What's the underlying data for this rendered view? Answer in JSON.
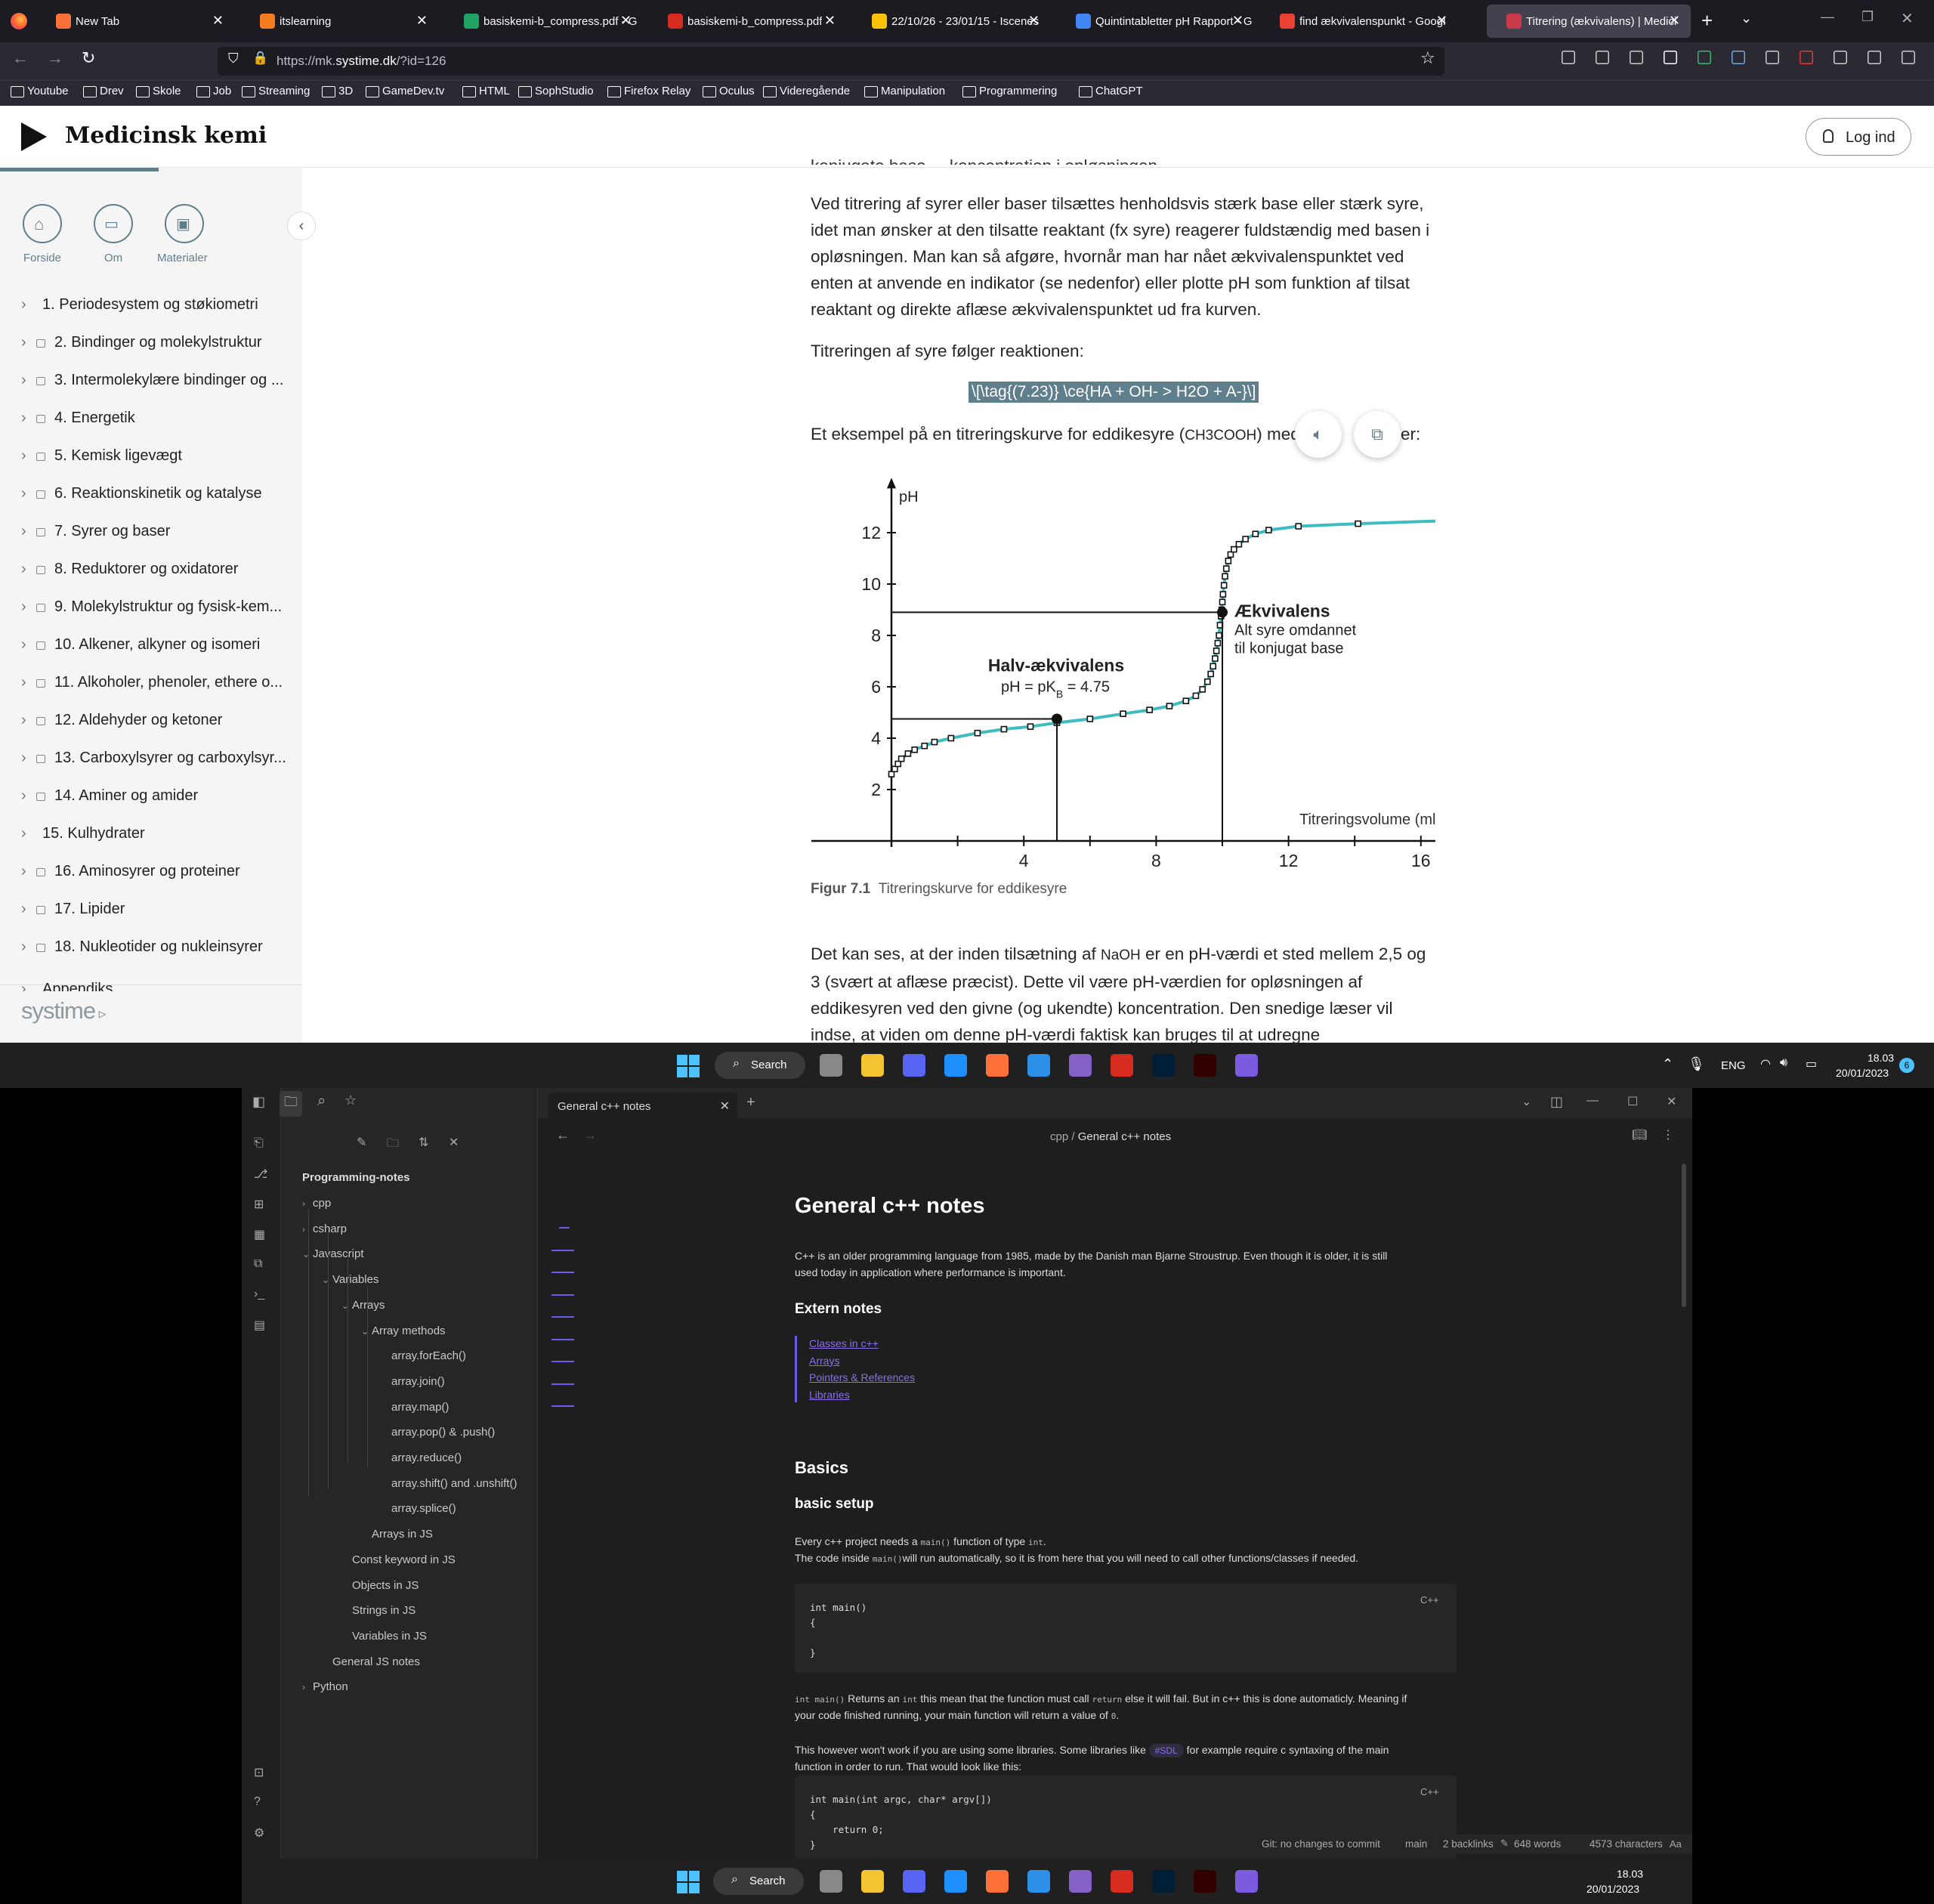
{
  "browser": {
    "tabs": [
      {
        "label": "New Tab",
        "color": "#ff7139"
      },
      {
        "label": "itslearning",
        "color": "#f47c20"
      },
      {
        "label": "basiskemi-b_compress.pdf - G",
        "color": "#1fa463"
      },
      {
        "label": "basiskemi-b_compress.pdf",
        "color": "#d62c1f"
      },
      {
        "label": "22/10/26 - 23/01/15 - Iscenes",
        "color": "#ffc107"
      },
      {
        "label": "Quintintabletter pH Rapport - G",
        "color": "#4285f4"
      },
      {
        "label": "find ækvivalenspunkt - Googl",
        "color": "#ea4335"
      },
      {
        "label": "Titrering (ækvivalens) | Medici",
        "color": "#c93a4a"
      }
    ],
    "url_prefix": "https://mk.",
    "url_domain": "systime.dk",
    "url_path": "/?id=126",
    "bookmarks": [
      "Youtube",
      "Drev",
      "Skole",
      "Job",
      "Streaming",
      "3D",
      "GameDev.tv",
      "HTML",
      "SophStudio",
      "Firefox Relay",
      "Oculus",
      "Videregående",
      "Manipulation",
      "Programmering",
      "ChatGPT"
    ]
  },
  "site": {
    "title": "Medicinsk kemi",
    "login": "Log ind",
    "nav": [
      "Forside",
      "Om",
      "Materialer"
    ],
    "chapters": [
      {
        "label": "1. Periodesystem og støkiometri",
        "locked": false
      },
      {
        "label": "2. Bindinger og molekylstruktur",
        "locked": true
      },
      {
        "label": "3. Intermolekylære bindinger og ...",
        "locked": true
      },
      {
        "label": "4. Energetik",
        "locked": true
      },
      {
        "label": "5. Kemisk ligevægt",
        "locked": true
      },
      {
        "label": "6. Reaktionskinetik og katalyse",
        "locked": true
      },
      {
        "label": "7. Syrer og baser",
        "locked": true
      },
      {
        "label": "8. Reduktorer og oxidatorer",
        "locked": true
      },
      {
        "label": "9. Molekylstruktur og fysisk-kem...",
        "locked": true
      },
      {
        "label": "10. Alkener, alkyner og isomeri",
        "locked": true
      },
      {
        "label": "11. Alkoholer, phenoler, ethere o...",
        "locked": true
      },
      {
        "label": "12. Aldehyder og ketoner",
        "locked": true
      },
      {
        "label": "13. Carboxylsyrer og carboxylsyr...",
        "locked": true
      },
      {
        "label": "14. Aminer og amider",
        "locked": true
      },
      {
        "label": "15. Kulhydrater",
        "locked": false
      },
      {
        "label": "16. Aminosyrer og proteiner",
        "locked": true
      },
      {
        "label": "17. Lipider",
        "locked": true
      },
      {
        "label": "18. Nukleotider og nukleinsyrer",
        "locked": true
      },
      {
        "label": "Appendiks",
        "locked": false
      }
    ],
    "brand": "systime",
    "top_cut": "konjugate base ... koncentration i opløsningen.",
    "para1": "Ved titrering af syrer eller baser tilsættes henholdsvis stærk base eller stærk syre, idet man ønsker at den tilsatte reaktant (fx syre) reagerer fuldstændig med basen i opløsningen. Man kan så afgøre, hvornår man har nået ækvivalenspunktet ved enten at anvende en indikator (se nedenfor) eller plotte pH som funktion af tilsat reaktant og direkte aflæse ækvivalenspunktet ud fra kurven.",
    "para2": "Titreringen af syre følger reaktionen:",
    "formula": "\\[\\tag{(7.23)} \\ce{HA + OH- > H2O + A-}\\]",
    "para3a": "Et eksempel på en titreringskurve for eddikesyre (",
    "para3b": "CH3COOH",
    "para3c": ") med",
    "para3d": "er:",
    "fig_num": "Figur 7.1",
    "fig_caption": "Titreringskurve for eddikesyre",
    "para4a": "Det kan ses, at der inden tilsætning af ",
    "para4b": "NaOH",
    "para4c": " er en pH-værdi et sted mellem 2,5 og 3 (svært at aflæse præcist). Dette vil være pH-værdien for opløsningen af eddikesyren ved den givne (og ukendte) koncentration. Den snedige læser vil indse, at viden om denne pH-værdi faktisk kan bruges til at udregne"
  },
  "chart_data": {
    "type": "line",
    "ylabel": "pH",
    "xlabel": "Titreringsvolume (ml)",
    "xticks": [
      4,
      8,
      12,
      16
    ],
    "yticks": [
      2,
      4,
      6,
      8,
      10,
      12
    ],
    "xlim": [
      -1,
      17.5
    ],
    "ylim": [
      0,
      14
    ],
    "series": [
      {
        "color": "#3fbcc0",
        "x": [
          0.0,
          0.1,
          0.2,
          0.3,
          0.5,
          0.7,
          1.0,
          1.3,
          1.8,
          2.6,
          3.4,
          4.2,
          5.0,
          6.0,
          7.0,
          7.8,
          8.4,
          8.9,
          9.2,
          9.4,
          9.55,
          9.65,
          9.72,
          9.78,
          9.82,
          9.86,
          9.9,
          9.93,
          9.96,
          9.98,
          10.0,
          10.02,
          10.05,
          10.08,
          10.12,
          10.18,
          10.25,
          10.35,
          10.5,
          10.7,
          11.0,
          11.4,
          12.3,
          14.1,
          17.5
        ],
        "y": [
          2.6,
          2.8,
          3.0,
          3.2,
          3.4,
          3.55,
          3.7,
          3.85,
          4.0,
          4.2,
          4.35,
          4.45,
          4.6,
          4.75,
          4.95,
          5.1,
          5.25,
          5.45,
          5.65,
          5.9,
          6.2,
          6.5,
          6.8,
          7.1,
          7.4,
          7.7,
          8.0,
          8.4,
          8.75,
          9.0,
          9.3,
          9.6,
          9.95,
          10.3,
          10.6,
          10.9,
          11.15,
          11.35,
          11.55,
          11.75,
          11.95,
          12.1,
          12.25,
          12.35,
          12.5
        ]
      }
    ],
    "markers": [
      {
        "label": "Halv-ækvivalens",
        "sub_pre": "pH = pK",
        "sub_sub": "B",
        "sub_post": " = 4.75",
        "x": 5,
        "y": 4.75
      },
      {
        "label": "Ækvivalens",
        "sub1": "Alt syre omdannet",
        "sub2": "til konjugat base",
        "x": 10,
        "y": 8.9
      }
    ]
  },
  "taskbar": {
    "search": "Search",
    "lang": "ENG",
    "time": "18.03",
    "date": "20/01/2023",
    "badge": "6"
  },
  "obsidian": {
    "tab_title": "General c++ notes",
    "breadcrumb_folder": "cpp",
    "breadcrumb_file": "General c++ notes",
    "vault": "Programming-notes",
    "tree": [
      {
        "label": "cpp",
        "indent": 0,
        "chev": "›"
      },
      {
        "label": "csharp",
        "indent": 0,
        "chev": "›"
      },
      {
        "label": "Javascript",
        "indent": 0,
        "chev": "⌄"
      },
      {
        "label": "Variables",
        "indent": 1,
        "chev": "⌄"
      },
      {
        "label": "Arrays",
        "indent": 2,
        "chev": "⌄"
      },
      {
        "label": "Array methods",
        "indent": 3,
        "chev": "⌄"
      },
      {
        "label": "array.forEach()",
        "indent": 4,
        "chev": ""
      },
      {
        "label": "array.join()",
        "indent": 4,
        "chev": ""
      },
      {
        "label": "array.map()",
        "indent": 4,
        "chev": ""
      },
      {
        "label": "array.pop() & .push()",
        "indent": 4,
        "chev": ""
      },
      {
        "label": "array.reduce()",
        "indent": 4,
        "chev": ""
      },
      {
        "label": "array.shift() and .unshift()",
        "indent": 4,
        "chev": ""
      },
      {
        "label": "array.splice()",
        "indent": 4,
        "chev": ""
      },
      {
        "label": "Arrays in JS",
        "indent": 3,
        "chev": ""
      },
      {
        "label": "Const keyword in JS",
        "indent": 2,
        "chev": ""
      },
      {
        "label": "Objects in JS",
        "indent": 2,
        "chev": ""
      },
      {
        "label": "Strings in JS",
        "indent": 2,
        "chev": ""
      },
      {
        "label": "Variables in JS",
        "indent": 2,
        "chev": ""
      },
      {
        "label": "General JS notes",
        "indent": 1,
        "chev": ""
      },
      {
        "label": "Python",
        "indent": 0,
        "chev": "›"
      }
    ],
    "doc_title": "General c++ notes",
    "intro": "C++ is an older programming language from 1985, made by the Danish man Bjarne Stroustrup. Even though it is older, it is still",
    "intro2": "used today in application where performance is important.",
    "extern_heading": "Extern notes",
    "links": [
      "Classes in c++",
      "Arrays",
      "Pointers & References",
      "Libraries"
    ],
    "basics_heading": "Basics",
    "setup_heading": "basic setup",
    "setup1a": "Every c++ project needs a ",
    "setup1b": "main()",
    "setup1c": " function of type ",
    "setup1d": "int",
    "setup2a": "The code inside ",
    "setup2b": "main()",
    "setup2c": "will run automatically, so it is from here that you will need to call other functions/classes if needed.",
    "code1": [
      "int main()",
      "{",
      "",
      "}"
    ],
    "lang": "C++",
    "p3a": "int main()",
    "p3b": " Returns an ",
    "p3c": "int",
    "p3d": " this mean that the function must call ",
    "p3e": "return",
    "p3f": " else it will fail. But in c++ this is done automaticly. Meaning if",
    "p3g": "your code finished running, your main function will return a value of ",
    "p3h": "0",
    "p4a": "This however won't work if you are using some libraries. Some libraries like",
    "p4tag": "#SDL",
    "p4b": "for example require c syntaxing of the main",
    "p4c": "function in order to run. That would look like this:",
    "code2": [
      "int main(int argc, char* argv[])",
      "{",
      "    return 0;",
      "}"
    ],
    "status": [
      "Git: no changes to commit",
      "main",
      "2 backlinks",
      "648 words",
      "4573 characters"
    ]
  }
}
